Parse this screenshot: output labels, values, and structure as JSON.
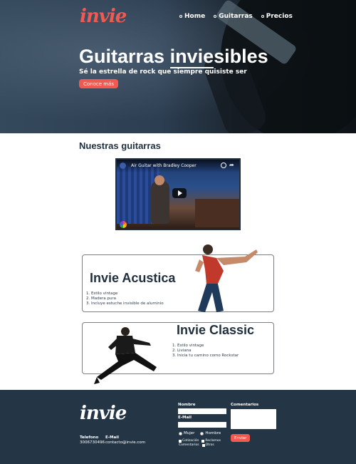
{
  "brand": {
    "logo_text": "invie",
    "accent_color": "#f05a50",
    "dark_color": "#243545"
  },
  "nav": {
    "items": [
      {
        "label": "Home"
      },
      {
        "label": "Guitarras"
      },
      {
        "label": "Precios"
      }
    ]
  },
  "hero": {
    "title_prefix": "Guitarras ",
    "title_highlight": "invie",
    "title_suffix": "sibles",
    "subtitle": "Sé la estrella de rock que siempre quisiste ser",
    "cta_label": "Conoce más"
  },
  "guitars_section": {
    "title": "Nuestras guitarras"
  },
  "video": {
    "title": "Air Guitar with Bradley Cooper",
    "icons": [
      "clock-icon",
      "share-icon",
      "play-icon",
      "nbc-logo-icon"
    ]
  },
  "products": [
    {
      "name": "Invie Acustica",
      "features": [
        "1. Estilo vintage",
        "2. Madera pura",
        "3. Incluye estuche invisible de aluminio"
      ]
    },
    {
      "name": "Invie Classic",
      "features": [
        "1. Estilo vintage",
        "2. Liviana",
        "3. Inicia tu camino como Rockstar"
      ]
    }
  ],
  "footer": {
    "logo_text": "invie",
    "contact": {
      "phone_label": "Telefono",
      "phone_value": "3006730496",
      "email_label": "E-Mail",
      "email_value": "contacto@invie.com"
    },
    "form": {
      "name_label": "Nombre",
      "email_label": "E-Mail",
      "comments_label": "Comentarios",
      "gender_options": [
        "Mujer",
        "Hombre"
      ],
      "checkbox_options": [
        "Cotización",
        "Reclamos",
        "Comentarios",
        "Otros"
      ],
      "submit_label": "Enviar"
    }
  }
}
